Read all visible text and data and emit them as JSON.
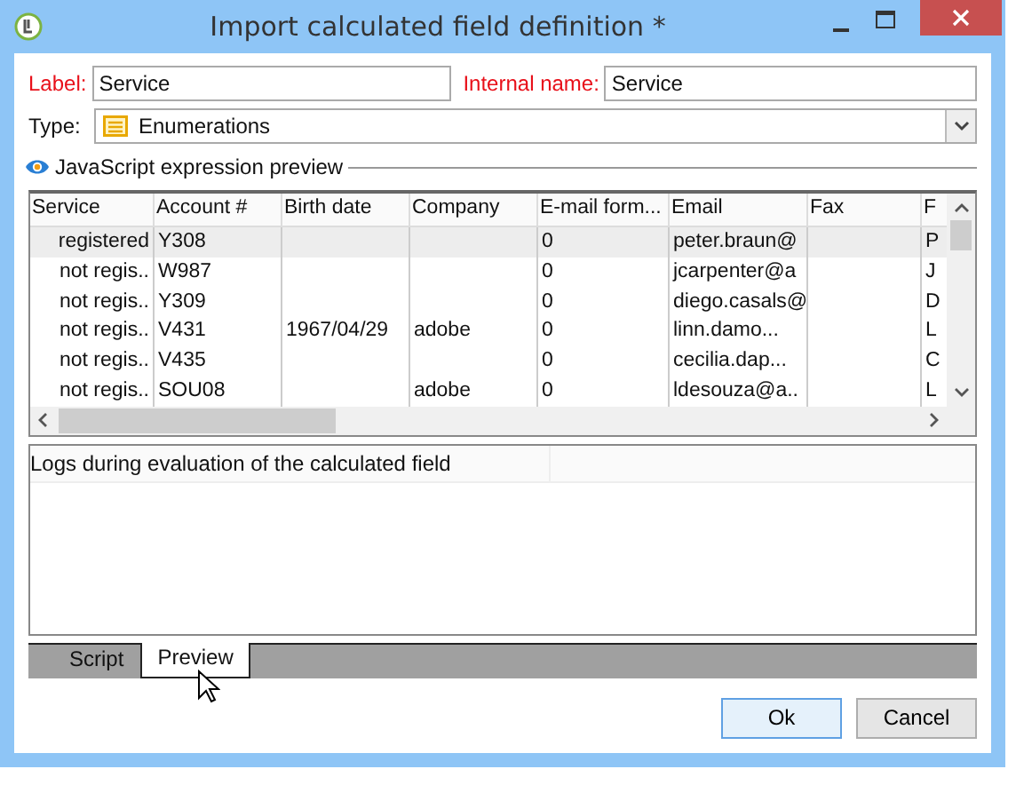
{
  "window": {
    "title": "Import calculated field definition *"
  },
  "label": {
    "caption": "Label:",
    "value": "Service"
  },
  "internal_name": {
    "caption": "Internal name:",
    "value": "Service"
  },
  "type": {
    "caption": "Type:",
    "value": "Enumerations"
  },
  "preview_heading": "JavaScript expression preview",
  "table": {
    "columns": [
      "Service",
      "Account #",
      "Birth date",
      "Company",
      "E-mail form...",
      "Email",
      "Fax",
      "F"
    ],
    "rows": [
      {
        "selected": true,
        "cells": [
          "registered",
          "Y308",
          "",
          "",
          "0",
          "peter.braun@",
          "",
          "P"
        ]
      },
      {
        "selected": false,
        "cells": [
          "not regis..",
          "W987",
          "",
          "",
          "0",
          "jcarpenter@a",
          "",
          "J"
        ]
      },
      {
        "selected": false,
        "cells": [
          "not regis..",
          "Y309",
          "",
          "",
          "0",
          "diego.casals@",
          "",
          "D"
        ]
      },
      {
        "selected": false,
        "cells": [
          "not regis..",
          "V431",
          "1967/04/29",
          "adobe",
          "0",
          "linn.damo...",
          "",
          "L"
        ]
      },
      {
        "selected": false,
        "cells": [
          "not regis..",
          "V435",
          "",
          "",
          "0",
          "cecilia.dap...",
          "",
          "C"
        ]
      },
      {
        "selected": false,
        "cells": [
          "not regis..",
          "SOU08",
          "",
          "adobe",
          "0",
          "ldesouza@a..",
          "",
          "L"
        ]
      }
    ]
  },
  "logs": {
    "header": "Logs during evaluation of the calculated field"
  },
  "tabs": [
    {
      "label": "Script",
      "selected": false
    },
    {
      "label": "Preview",
      "selected": true
    }
  ],
  "buttons": [
    {
      "label": "Ok",
      "default": true
    },
    {
      "label": "Cancel",
      "default": false
    }
  ]
}
